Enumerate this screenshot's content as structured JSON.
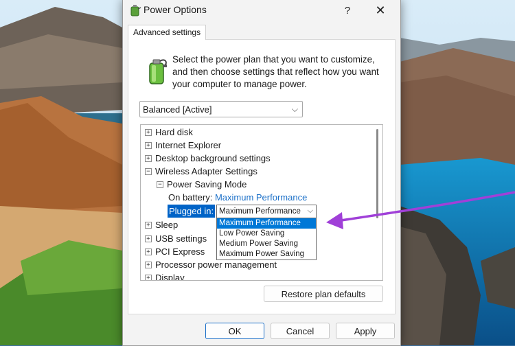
{
  "window": {
    "title": "Power Options",
    "help_glyph": "?",
    "close_glyph": "✕"
  },
  "tab": {
    "label": "Advanced settings"
  },
  "description": "Select the power plan that you want to customize, and then choose settings that reflect how you want your computer to manage power.",
  "plan_select": {
    "value": "Balanced [Active]",
    "chevron": "⌵"
  },
  "tree": {
    "items": [
      {
        "expander": "+",
        "label": "Hard disk"
      },
      {
        "expander": "+",
        "label": "Internet Explorer"
      },
      {
        "expander": "+",
        "label": "Desktop background settings"
      },
      {
        "expander": "−",
        "label": "Wireless Adapter Settings"
      },
      {
        "expander": "−",
        "label": "Power Saving Mode"
      },
      {
        "expander": "+",
        "label": "Sleep"
      },
      {
        "expander": "+",
        "label": "USB settings"
      },
      {
        "expander": "+",
        "label": "PCI Express"
      },
      {
        "expander": "+",
        "label": "Processor power management"
      },
      {
        "expander": "+",
        "label": "Display"
      }
    ],
    "on_battery_label": "On battery:",
    "on_battery_value": "Maximum Performance",
    "plugged_in_label": "Plugged in:",
    "plugged_in_value": "Maximum Performance",
    "dropdown_options": [
      "Maximum Performance",
      "Low Power Saving",
      "Medium Power Saving",
      "Maximum Power Saving"
    ],
    "dropdown_selected": "Maximum Performance"
  },
  "buttons": {
    "restore": "Restore plan defaults",
    "ok": "OK",
    "cancel": "Cancel",
    "apply": "Apply"
  },
  "colors": {
    "selection": "#0078d7",
    "link": "#1a6fc8",
    "annotation_arrow": "#a040d8"
  },
  "icons": {
    "title": "power-options-icon",
    "plan": "battery-plug-icon"
  }
}
